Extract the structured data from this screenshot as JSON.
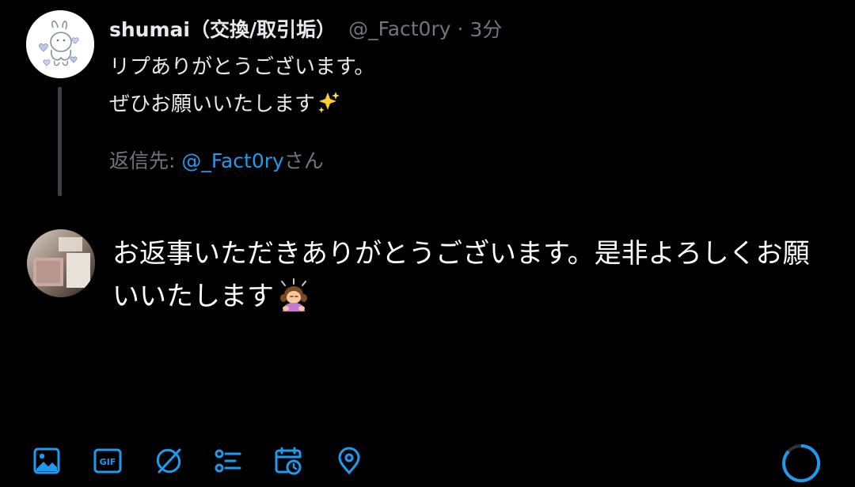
{
  "original_tweet": {
    "display_name": "shumai（交換/取引垢）",
    "handle": "@_Fact0ry",
    "separator": "·",
    "time": "3分",
    "text_lines": [
      "リプありがとうございます。",
      "ぜひお願いいたします"
    ],
    "text_emoji": "sparkles",
    "replying_to": {
      "prefix": "返信先: ",
      "mention": "@_Fact0ry",
      "suffix": "さん"
    }
  },
  "reply": {
    "text": "お返事いただきありがとうございます。是非よろしくお願いいたします",
    "trailing_emoji": "person-bowing"
  },
  "toolbar": {
    "icons": [
      "image-icon",
      "gif-icon",
      "grok-icon",
      "poll-icon",
      "schedule-icon",
      "location-icon"
    ],
    "gif_label": "GIF"
  },
  "colors": {
    "background": "#000000",
    "text_primary": "#e7e9ea",
    "text_secondary": "#71767b",
    "accent": "#1d9bf0",
    "thread_line": "#3e4144"
  }
}
